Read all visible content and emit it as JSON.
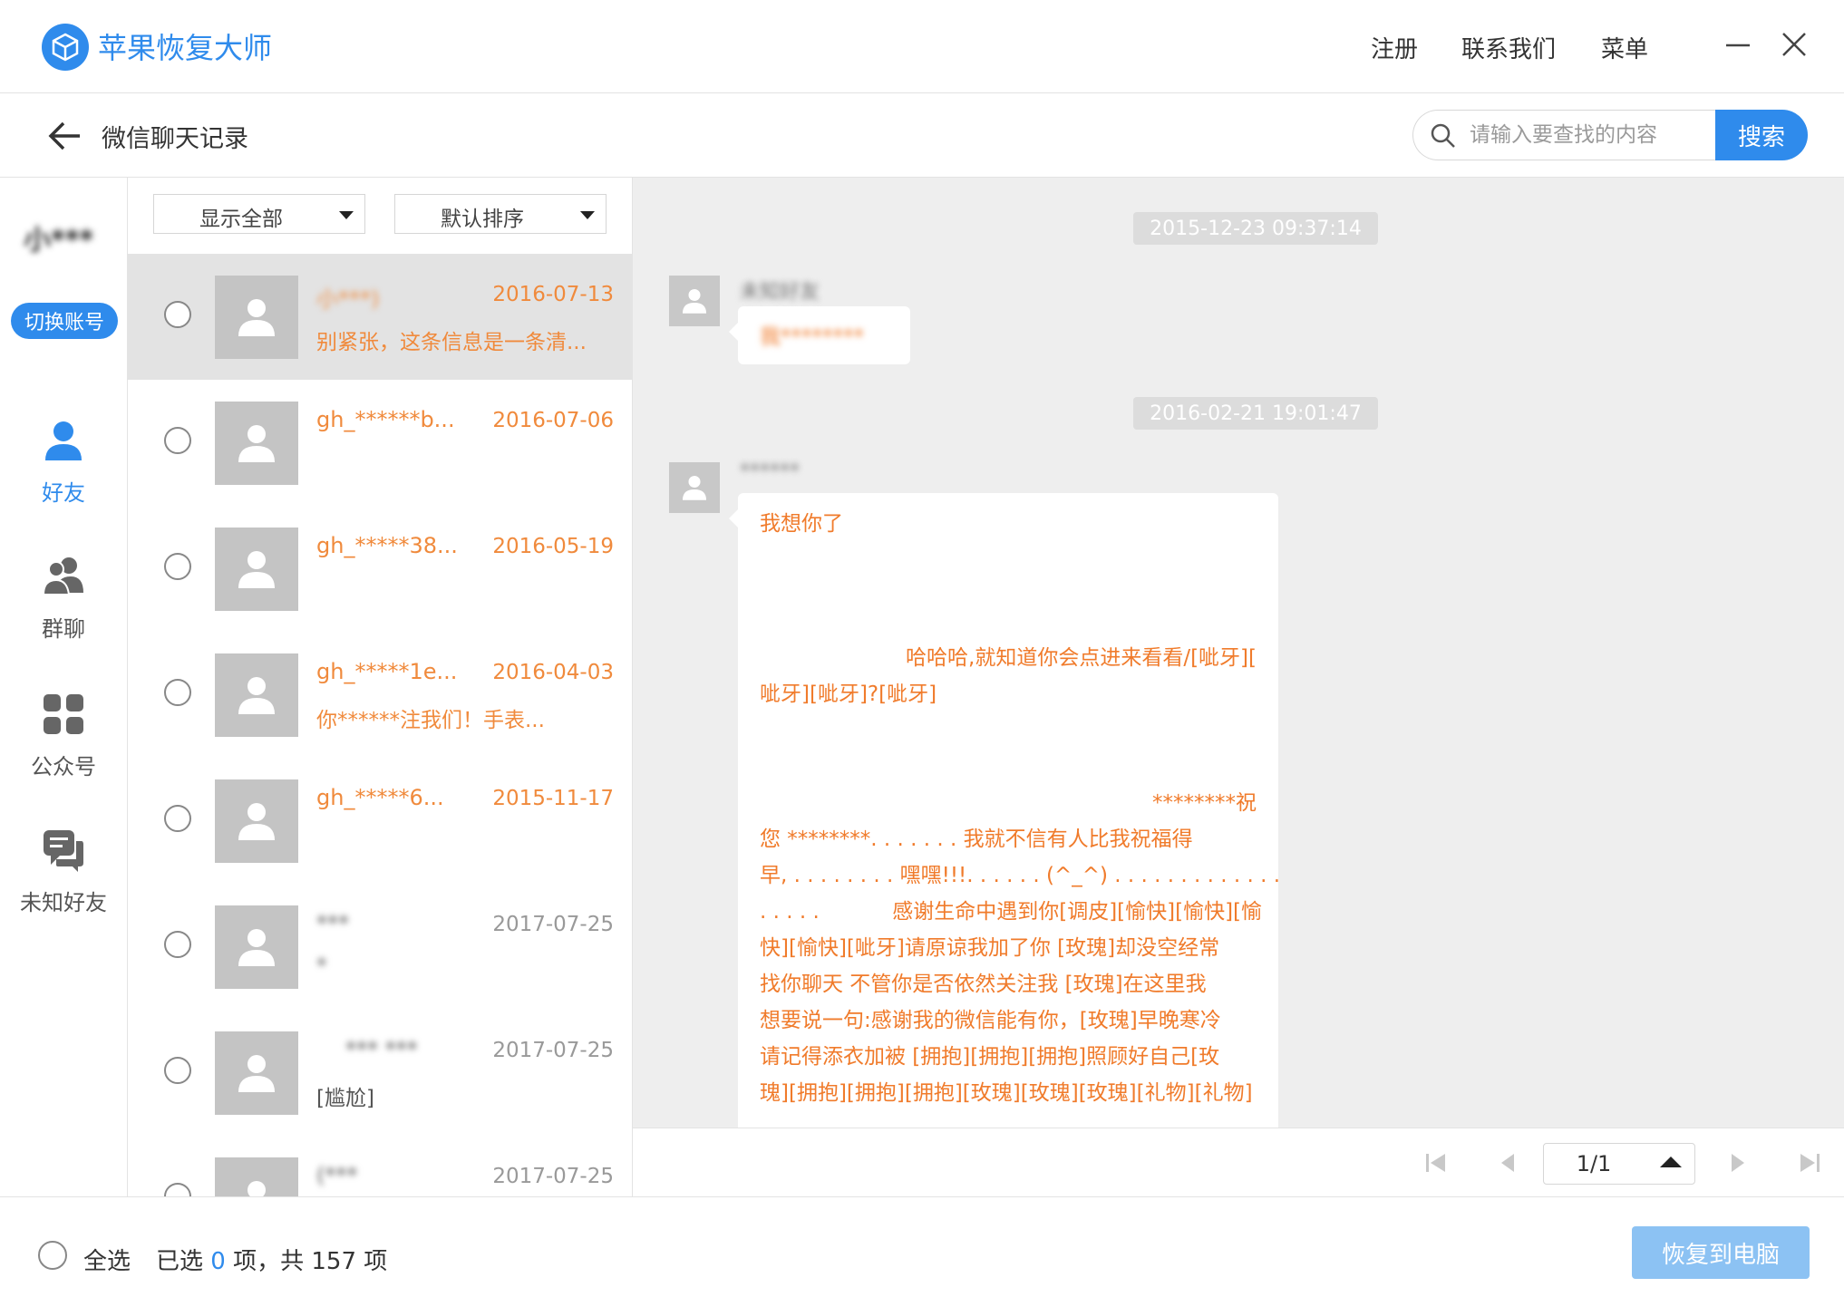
{
  "app": {
    "title": "苹果恢复大师",
    "logo_icon": "box-logo-icon"
  },
  "topbar": {
    "register": "注册",
    "contact": "联系我们",
    "menu": "菜单"
  },
  "header": {
    "title": "微信聊天记录"
  },
  "search": {
    "placeholder": "请输入要查找的内容",
    "button": "搜索"
  },
  "account": {
    "name": "小***",
    "switch_label": "切换账号"
  },
  "nav": [
    {
      "label": "好友",
      "icon": "person-icon",
      "active": true
    },
    {
      "label": "群聊",
      "icon": "group-icon",
      "active": false
    },
    {
      "label": "公众号",
      "icon": "grid-icon",
      "active": false
    },
    {
      "label": "未知好友",
      "icon": "chat-bubble-icon",
      "active": false
    }
  ],
  "filters": {
    "show": "显示全部",
    "sort": "默认排序"
  },
  "list": [
    {
      "name": "小***)",
      "date": "2016-07-13",
      "preview": "别紧张，这条信息是一条清...",
      "color": "orange",
      "selected": true,
      "checked": false
    },
    {
      "name": "gh_******b...",
      "date": "2016-07-06",
      "preview": "",
      "color": "orange",
      "selected": false,
      "checked": false
    },
    {
      "name": "gh_*****38...",
      "date": "2016-05-19",
      "preview": "",
      "color": "orange",
      "selected": false,
      "checked": false
    },
    {
      "name": "gh_*****1e...",
      "date": "2016-04-03",
      "preview": "你******注我们！手表...",
      "color": "orange",
      "selected": false,
      "checked": false
    },
    {
      "name": "gh_*****6...",
      "date": "2015-11-17",
      "preview": "",
      "color": "orange",
      "selected": false,
      "checked": false
    },
    {
      "name": "***",
      "date": "2017-07-25",
      "preview": "*",
      "color": "gray",
      "selected": false,
      "checked": false
    },
    {
      "name": "*** ***",
      "date": "2017-07-25",
      "preview": "[尴尬]",
      "color": "gray",
      "selected": false,
      "checked": false
    },
    {
      "name": "(***",
      "date": "2017-07-25",
      "preview": "",
      "color": "gray",
      "selected": false,
      "checked": false
    }
  ],
  "chat": {
    "messages": [
      {
        "timestamp": "2015-12-23 09:37:14",
        "sender": "未知好友",
        "text": "我********"
      },
      {
        "timestamp": "2016-02-21 19:01:47",
        "sender": "******",
        "lines": [
          "我想你了",
          "",
          "",
          "",
          "哈哈哈,就知道你会点进来看看/[呲牙][",
          "呲牙][呲牙]?[呲牙]",
          "",
          "",
          "********祝",
          "您 ********. . . . . . .  我就不信有人比我祝福得",
          "早, . . . . . . . .  嘿嘿!!!. . . . . .  (^_^)  . . . . . . . . .  . . . .",
          ". . . . .           感谢生命中遇到你[调皮][愉快][愉快][愉",
          "快][愉快][呲牙]请原谅我加了你   [玫瑰]却没空经常",
          "找你聊天   不管你是否依然关注我    [玫瑰]在这里我",
          "想要说一句:感谢我的微信能有你，[玫瑰]早晚寒冷",
          "请记得添衣加被    [拥抱][拥抱][拥抱]照顾好自己[玫",
          "瑰][拥抱][拥抱][拥抱][玫瑰][玫瑰][玫瑰][礼物][礼物]"
        ]
      }
    ]
  },
  "pager": {
    "value": "1/1"
  },
  "footer": {
    "select_all": "全选",
    "selected_prefix": "已选",
    "selected_count": "0",
    "selected_suffix": "项，共 157 项",
    "restore": "恢复到电脑"
  },
  "colors": {
    "accent": "#2f8bec",
    "orange": "#f08a3c",
    "restore_disabled": "#8cc2f3"
  }
}
